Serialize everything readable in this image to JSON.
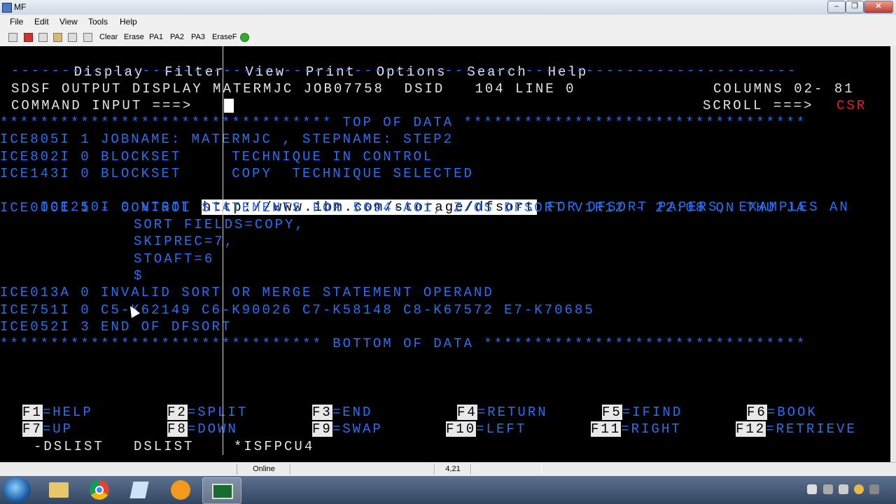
{
  "window": {
    "title": "MF"
  },
  "menubar": [
    "File",
    "Edit",
    "View",
    "Tools",
    "Help"
  ],
  "toolbar": {
    "buttons": [
      "Clear",
      "Erase",
      "PA1",
      "PA2",
      "PA3",
      "EraseF"
    ]
  },
  "terminal": {
    "menu": [
      "Display",
      "Filter",
      "View",
      "Print",
      "Options",
      "Search",
      "Help"
    ],
    "dashes": "------------------------------------------------------------------------------",
    "header": {
      "title": "SDSF OUTPUT DISPLAY MATERMJC JOB07758  DSID   104 LINE 0",
      "columns": "COLUMNS 02- 81",
      "command_label": "COMMAND INPUT ===>",
      "scroll_label": "SCROLL ===>",
      "scroll_value": "CSR"
    },
    "top_of_data": "********************************* TOP OF DATA **********************************",
    "lines": [
      "ICE805I 1 JOBNAME: MATERMJC , STEPNAME: STEP2",
      "ICE802I 0 BLOCKSET     TECHNIQUE IN CONTROL",
      "ICE143I 0 BLOCKSET     COPY  TECHNIQUE SELECTED"
    ],
    "visit_prefix": "ICE250I 0 VISIT ",
    "visit_url": "http://www.ibm.com/storage/dfsort",
    "visit_suffix": " FOR DFSORT PAPERS, EXAMPLES AN",
    "line_ice000": "ICE000I 1 - CONTROL STATEMENTS FOR 5694-A01, Z/OS DFSORT V1R12 - 22:08 ON THU JA",
    "control_statements": [
      "SORT FIELDS=COPY,",
      "SKIPREC=7,",
      "STOAFT=6",
      "$"
    ],
    "messages": [
      "ICE013A 0 INVALID SORT OR MERGE STATEMENT OPERAND",
      "ICE751I 0 C5-K62149 C6-K90026 C7-K58148 C8-K67572 E7-K70685",
      "ICE052I 3 END OF DFSORT"
    ],
    "bottom_of_data": "******************************** BOTTOM OF DATA ********************************",
    "fkeys_row1": [
      {
        "key": "F1",
        "label": "=HELP"
      },
      {
        "key": "F2",
        "label": "=SPLIT"
      },
      {
        "key": "F3",
        "label": "=END"
      },
      {
        "key": "F4",
        "label": "=RETURN"
      },
      {
        "key": "F5",
        "label": "=IFIND"
      },
      {
        "key": "F6",
        "label": "=BOOK"
      }
    ],
    "fkeys_row2": [
      {
        "key": "F7",
        "label": "=UP"
      },
      {
        "key": "F8",
        "label": "=DOWN"
      },
      {
        "key": "F9",
        "label": "=SWAP"
      },
      {
        "key": "F10",
        "label": "=LEFT"
      },
      {
        "key": "F11",
        "label": "=RIGHT"
      },
      {
        "key": "F12",
        "label": "=RETRIEVE"
      }
    ],
    "sessions": [
      "-DSLIST",
      "DSLIST",
      "*ISFPCU4"
    ]
  },
  "statusbar": {
    "state": "Online",
    "position": "4,21"
  },
  "taskbar": {
    "apps": [
      "windows-explorer-icon",
      "chrome-icon",
      "notepad-icon",
      "app-icon",
      "terminal-icon"
    ]
  }
}
